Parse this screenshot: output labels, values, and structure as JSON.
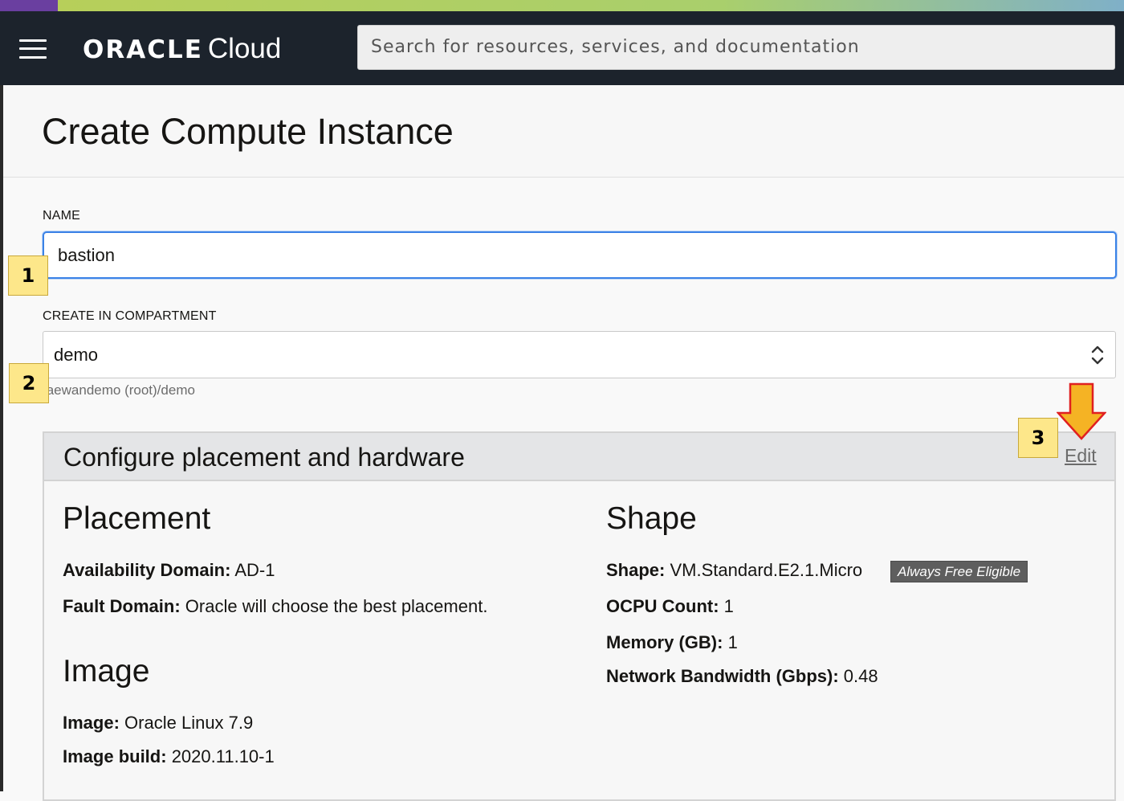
{
  "header": {
    "brand": "ORACLE",
    "product": "Cloud",
    "search_placeholder": "Search for resources, services, and documentation"
  },
  "page": {
    "title": "Create Compute Instance"
  },
  "form": {
    "name_label": "NAME",
    "name_value": "bastion",
    "compartment_label": "CREATE IN COMPARTMENT",
    "compartment_value": "demo",
    "compartment_path": "taewandemo (root)/demo"
  },
  "panel": {
    "title": "Configure placement and hardware",
    "edit_label": "Edit",
    "placement": {
      "heading": "Placement",
      "availability_domain_label": "Availability Domain:",
      "availability_domain_value": "AD-1",
      "fault_domain_label": "Fault Domain:",
      "fault_domain_value": "Oracle will choose the best placement."
    },
    "image": {
      "heading": "Image",
      "image_label": "Image:",
      "image_value": "Oracle Linux 7.9",
      "build_label": "Image build:",
      "build_value": "2020.11.10-1"
    },
    "shape": {
      "heading": "Shape",
      "shape_label": "Shape:",
      "shape_value": "VM.Standard.E2.1.Micro",
      "badge": "Always Free Eligible",
      "ocpu_label": "OCPU Count:",
      "ocpu_value": "1",
      "memory_label": "Memory (GB):",
      "memory_value": "1",
      "bandwidth_label": "Network Bandwidth (Gbps):",
      "bandwidth_value": "0.48"
    }
  },
  "annotations": {
    "step1": "1",
    "step2": "2",
    "step3": "3"
  },
  "colors": {
    "topbar": "#1c232c",
    "focus_border": "#3b82e6",
    "annotation_fill": "#fde78a",
    "arrow_fill": "#f5b324",
    "arrow_stroke": "#e02020"
  },
  "icons": {
    "menu": "hamburger-menu-icon",
    "select": "up-down-chevron-icon",
    "pointer": "down-arrow-callout"
  }
}
